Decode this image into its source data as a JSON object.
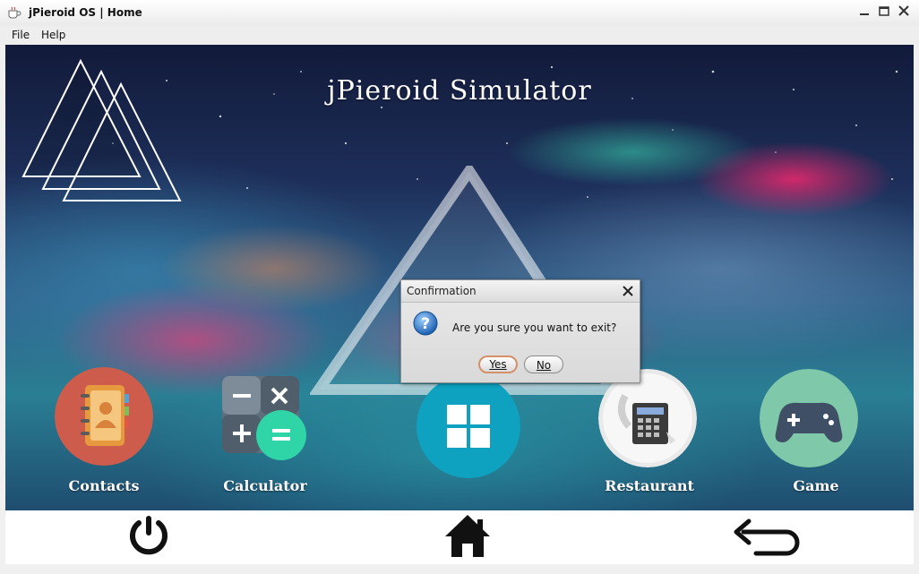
{
  "window": {
    "title": "jPieroid OS | Home"
  },
  "menu": {
    "items": [
      "File",
      "Help"
    ]
  },
  "main": {
    "title": "jPieroid Simulator"
  },
  "apps": [
    {
      "label": "Contacts",
      "icon": "contacts-book-icon",
      "color": "#cd5c4c"
    },
    {
      "label": "Calculator",
      "icon": "calculator-icon",
      "color": "#5f6f7c"
    },
    {
      "label": "",
      "icon": "app-grid-icon",
      "color": "#0ea2c0"
    },
    {
      "label": "Restaurant",
      "icon": "cash-register-icon",
      "color": "#e9e9e9"
    },
    {
      "label": "Game",
      "icon": "gamepad-icon",
      "color": "#7fc8a9"
    }
  ],
  "navbar": {
    "items": [
      "power-icon",
      "home-icon",
      "back-icon"
    ]
  },
  "dialog": {
    "title": "Confirmation",
    "message": "Are you sure you want to exit?",
    "yes_label": "Yes",
    "no_label": "No"
  }
}
